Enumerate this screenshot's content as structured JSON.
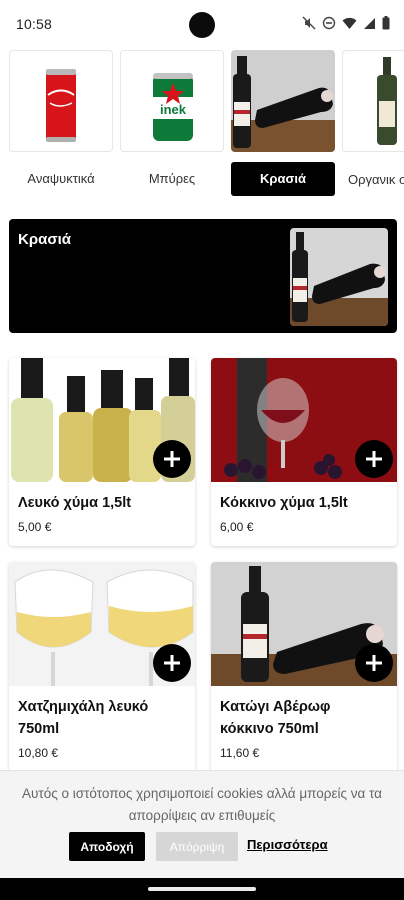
{
  "status_bar": {
    "time": "10:58",
    "icons": [
      "mute-icon",
      "dnd-icon",
      "wifi-icon",
      "signal-icon",
      "battery-icon"
    ]
  },
  "categories": [
    {
      "label": "Αναψυκτικά",
      "active": false,
      "thumb": "cola-can"
    },
    {
      "label": "Μπύρες",
      "active": false,
      "thumb": "beer-can"
    },
    {
      "label": "Κρασιά",
      "active": true,
      "thumb": "wine-bottle"
    },
    {
      "label": "Οργανικ σιά Λή",
      "active": false,
      "thumb": "olive-oil-bottle"
    }
  ],
  "banner": {
    "title": "Κρασιά"
  },
  "products": [
    {
      "name": "Λευκό χύμα 1,5lt",
      "price": "5,00 €",
      "image": "white-wine-bottles"
    },
    {
      "name": "Κόκκινο χύμα 1,5lt",
      "price": "6,00 €",
      "image": "red-wine-glass"
    },
    {
      "name": "Χατζημιχάλη λευκό 750ml",
      "price": "10,80 €",
      "image": "white-wine-glasses"
    },
    {
      "name": "Κατώγι Αβέρωφ κόκκινο 750ml",
      "price": "11,60 €",
      "image": "red-wine-bottle"
    }
  ],
  "cookie": {
    "text": "Αυτός ο ιστότοπος χρησιμοποιεί cookies αλλά μπορείς να τα απορρίψεις αν επιθυμείς",
    "accept": "Αποδοχή",
    "reject": "Απόρριψη",
    "more": "Περισσότερα"
  },
  "colors": {
    "accent": "#000000",
    "reject_button": "#d6d6d6",
    "cookie_background": "#f4f4f4"
  }
}
